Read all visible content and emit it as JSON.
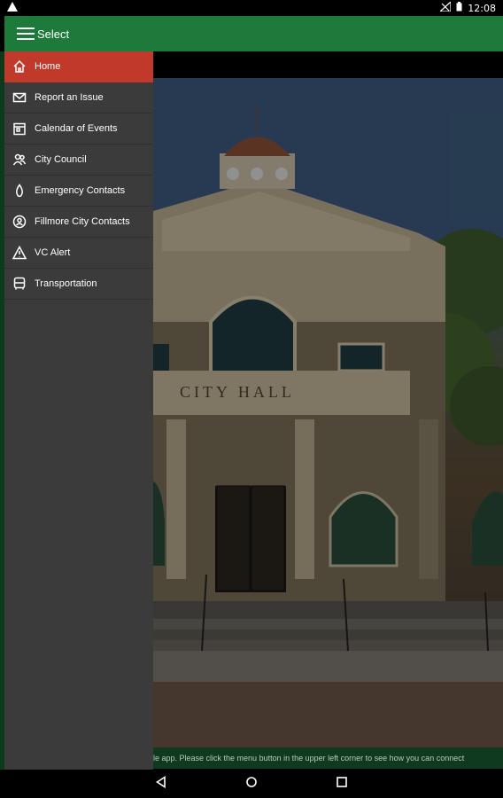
{
  "status_bar": {
    "time": "12:08",
    "left_icon": "warning-icon",
    "right_icons": [
      "signal-off-icon",
      "battery-icon"
    ]
  },
  "app_bar": {
    "title": "Select",
    "icon": "hamburger-menu-icon",
    "color": "#1e7a3a"
  },
  "drawer": {
    "active_color": "#c0392b",
    "items": [
      {
        "label": "Home",
        "icon": "home-icon",
        "active": true
      },
      {
        "label": "Report an Issue",
        "icon": "envelope-icon"
      },
      {
        "label": "Calendar of Events",
        "icon": "calendar-icon"
      },
      {
        "label": "City Council",
        "icon": "people-icon"
      },
      {
        "label": "Emergency Contacts",
        "icon": "flame-icon"
      },
      {
        "label": "Fillmore City Contacts",
        "icon": "contacts-icon"
      },
      {
        "label": "VC Alert",
        "icon": "alert-triangle-icon"
      },
      {
        "label": "Transportation",
        "icon": "bus-icon"
      }
    ]
  },
  "hero": {
    "sign_text": "CITY HALL"
  },
  "banner": {
    "text": "le app. Please click the menu button in the upper left corner to see how you can connect"
  },
  "nav_bar": {
    "buttons": [
      "back-icon",
      "home-circle-icon",
      "recents-square-icon"
    ]
  }
}
